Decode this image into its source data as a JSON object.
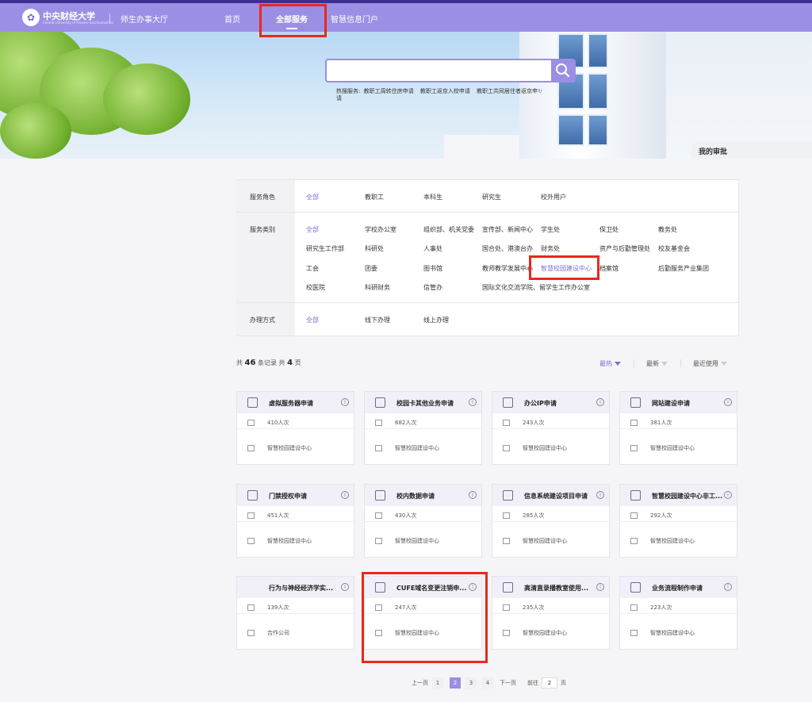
{
  "header": {
    "logo_text": "中央财经大学",
    "logo_sub": "Central University of Finance and Economics",
    "hall": "师生办事大厅",
    "nav": [
      "首页",
      "全部服务",
      "智慧信息门户"
    ]
  },
  "search": {
    "placeholder": "",
    "hot_label": "热搜服务:",
    "hot_items": [
      "教职工周转住房申请",
      "教职工返京入校申请",
      "教职工共同居住者返京申"
    ],
    "hot_wrap": "请"
  },
  "my_approval": "我的审批",
  "filters": {
    "role_label": "服务角色",
    "roles": [
      "全部",
      "教职工",
      "本科生",
      "研究生",
      "校外用户"
    ],
    "category_label": "服务类别",
    "categories_row1": [
      "全部",
      "学校办公室",
      "组织部、机关党委",
      "宣传部、新闻中心",
      "学生处",
      "保卫处",
      "教务处"
    ],
    "categories_row2": [
      "研究生工作部",
      "科研处",
      "人事处",
      "国合处、港澳台办",
      "财务处",
      "资产与后勤管理处",
      "校友基金会"
    ],
    "categories_row3": [
      "工会",
      "团委",
      "图书馆",
      "教师教学发展中心",
      "智慧校园建设中心",
      "档案馆",
      "后勤服务产业集团"
    ],
    "categories_row4": [
      "校医院",
      "科研财务",
      "信管办",
      "国际文化交流学院、留学生工作办公室"
    ],
    "method_label": "办理方式",
    "methods": [
      "全部",
      "线下办理",
      "线上办理"
    ]
  },
  "stats": {
    "prefix": "共",
    "total": "46",
    "mid": "条记录 共",
    "pages": "4",
    "suffix": "页"
  },
  "sort": [
    "最热",
    "最新",
    "最近使用"
  ],
  "cards": [
    {
      "title": "虚拟服务器申请",
      "count": "410人次",
      "dept": "智慧校园建设中心"
    },
    {
      "title": "校园卡其他业务申请",
      "count": "682人次",
      "dept": "智慧校园建设中心"
    },
    {
      "title": "办公IP申请",
      "count": "243人次",
      "dept": "智慧校园建设中心"
    },
    {
      "title": "网站建设申请",
      "count": "381人次",
      "dept": "智慧校园建设中心"
    },
    {
      "title": "门禁授权申请",
      "count": "451人次",
      "dept": "智慧校园建设中心"
    },
    {
      "title": "校内数据申请",
      "count": "430人次",
      "dept": "智慧校园建设中心"
    },
    {
      "title": "信息系统建设项目申请",
      "count": "285人次",
      "dept": "智慧校园建设中心"
    },
    {
      "title": "智慧校园建设中心非工...",
      "count": "292人次",
      "dept": "智慧校园建设中心"
    },
    {
      "title": "行为与神经经济学实...",
      "count": "139人次",
      "dept": "合作公司"
    },
    {
      "title": "CUFE域名变更注销申...",
      "count": "247人次",
      "dept": "智慧校园建设中心"
    },
    {
      "title": "高清直录播教室使用...",
      "count": "235人次",
      "dept": "智慧校园建设中心"
    },
    {
      "title": "业务流程制作申请",
      "count": "223人次",
      "dept": "智慧校园建设中心"
    }
  ],
  "pager": {
    "prev": "上一页",
    "pages": [
      "1",
      "2",
      "3",
      "4"
    ],
    "next": "下一页",
    "goto": "前往",
    "current": "2",
    "suffix": "页"
  },
  "colors": {
    "nav": "#9b8fe5",
    "accent": "#7a6fd0",
    "highlight": "#e8291c"
  }
}
